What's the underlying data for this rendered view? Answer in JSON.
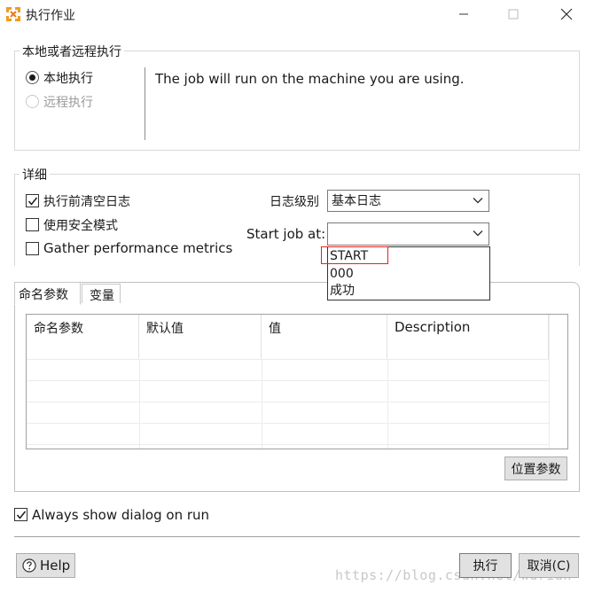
{
  "window": {
    "title": "执行作业",
    "controls": [
      "minimize",
      "maximize",
      "close"
    ]
  },
  "execution_group": {
    "legend": "本地或者远程执行",
    "options": [
      {
        "label": "本地执行",
        "selected": true,
        "enabled": true
      },
      {
        "label": "远程执行",
        "selected": false,
        "enabled": false
      }
    ],
    "description": "The job will run on the machine you are using."
  },
  "details_group": {
    "legend": "详细",
    "checkboxes": [
      {
        "label": "执行前清空日志",
        "checked": true
      },
      {
        "label": "使用安全模式",
        "checked": false
      },
      {
        "label": "Gather performance metrics",
        "checked": false
      }
    ],
    "log_level": {
      "label": "日志级别",
      "value": "基本日志"
    },
    "start_job": {
      "label": "Start job at:",
      "value": "",
      "options": [
        "START",
        "000",
        "成功"
      ],
      "highlighted": "START"
    }
  },
  "tabs": [
    {
      "label": "命名参数",
      "active": true
    },
    {
      "label": "变量",
      "active": false
    }
  ],
  "params_table": {
    "columns": [
      "命名参数",
      "默认值",
      "值",
      "Description"
    ],
    "rows": []
  },
  "position_params_button": "位置参数",
  "always_show": {
    "label": "Always show dialog on run",
    "checked": true
  },
  "footer": {
    "help_label": "Help",
    "run_label": "执行",
    "cancel_label": "取消(C)"
  },
  "watermark": "https://blog.csdn.net/wdrian"
}
